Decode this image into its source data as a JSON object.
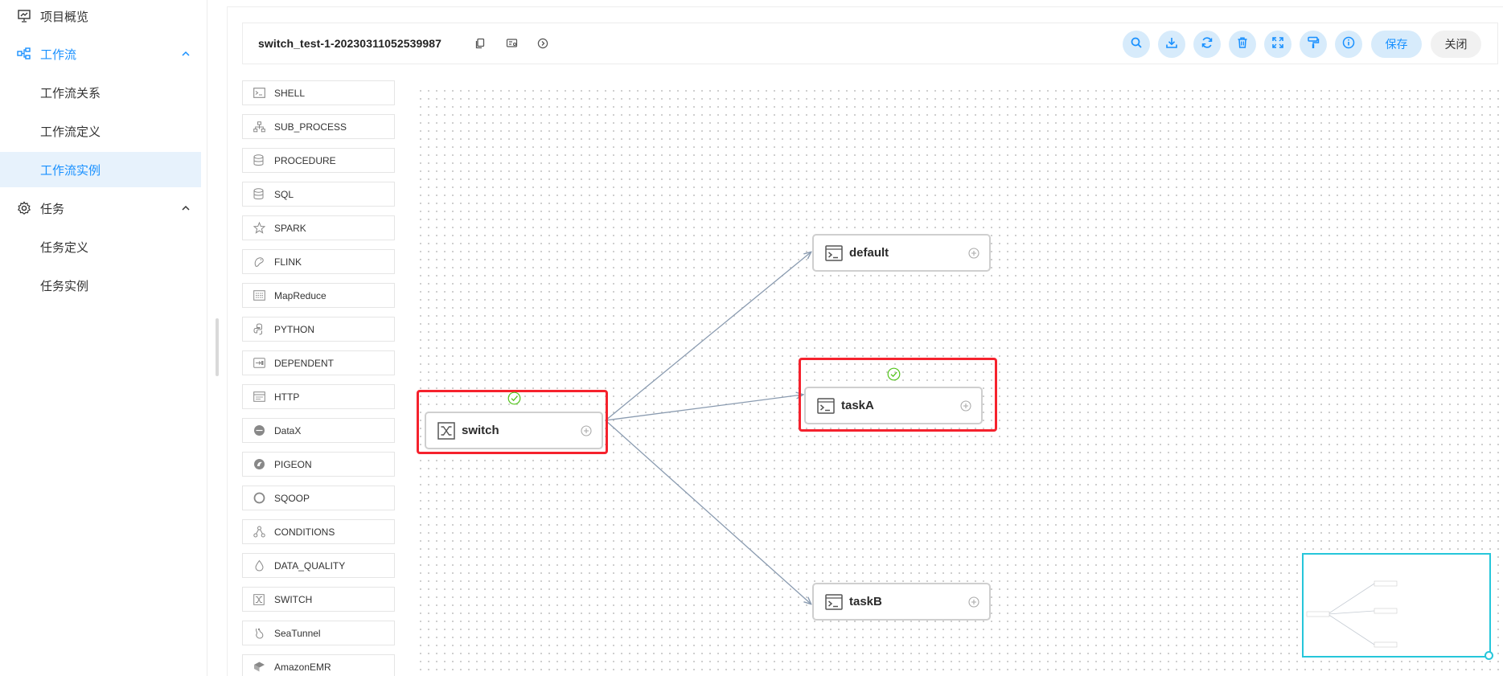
{
  "sidebar": {
    "items": [
      {
        "label": "项目概览",
        "icon": "presentation-icon"
      },
      {
        "label": "工作流",
        "icon": "workflow-icon"
      },
      {
        "label": "工作流关系"
      },
      {
        "label": "工作流定义"
      },
      {
        "label": "工作流实例"
      },
      {
        "label": "任务",
        "icon": "gear-icon"
      },
      {
        "label": "任务定义"
      },
      {
        "label": "任务实例"
      }
    ]
  },
  "toolbar": {
    "workflow_name": "switch_test-1-20230311052539987",
    "save_label": "保存",
    "close_label": "关闭"
  },
  "palette": {
    "items": [
      "SHELL",
      "SUB_PROCESS",
      "PROCEDURE",
      "SQL",
      "SPARK",
      "FLINK",
      "MapReduce",
      "PYTHON",
      "DEPENDENT",
      "HTTP",
      "DataX",
      "PIGEON",
      "SQOOP",
      "CONDITIONS",
      "DATA_QUALITY",
      "SWITCH",
      "SeaTunnel",
      "AmazonEMR"
    ]
  },
  "nodes": {
    "switch": {
      "label": "switch",
      "status": "success"
    },
    "default": {
      "label": "default"
    },
    "taskA": {
      "label": "taskA",
      "status": "success"
    },
    "taskB": {
      "label": "taskB"
    }
  },
  "colors": {
    "accent": "#1890ff",
    "highlight": "#f5222d",
    "success": "#52c41a",
    "minimap": "#26c6da",
    "edge": "#8a9bb0"
  }
}
